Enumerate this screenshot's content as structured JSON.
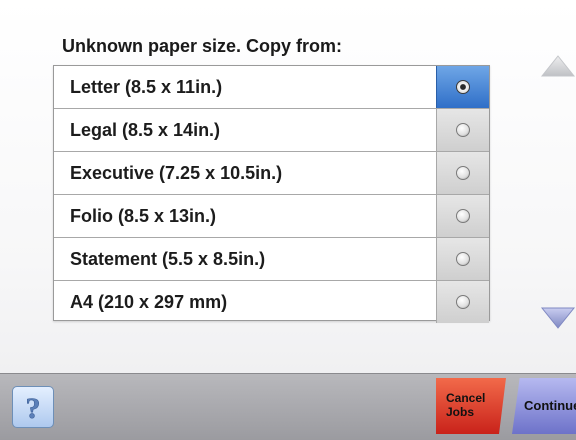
{
  "prompt": "Unknown paper size. Copy from:",
  "options": [
    {
      "label": "Letter (8.5 x 11in.)",
      "selected": true
    },
    {
      "label": "Legal (8.5 x 14in.)",
      "selected": false
    },
    {
      "label": "Executive (7.25 x 10.5in.)",
      "selected": false
    },
    {
      "label": "Folio (8.5 x 13in.)",
      "selected": false
    },
    {
      "label": "Statement (5.5 x 8.5in.)",
      "selected": false
    },
    {
      "label": "A4 (210 x 297 mm)",
      "selected": false
    }
  ],
  "bottom": {
    "help_icon_text": "?",
    "cancel_jobs_label": "Cancel Jobs",
    "continue_label": "Continue"
  },
  "colors": {
    "selected_accent": "#2f6fc8",
    "cancel_red": "#c9221a",
    "continue_purple": "#6d72c9",
    "scroll_arrow_up": "#c7c9cc",
    "scroll_arrow_down": "#8f98c8"
  }
}
